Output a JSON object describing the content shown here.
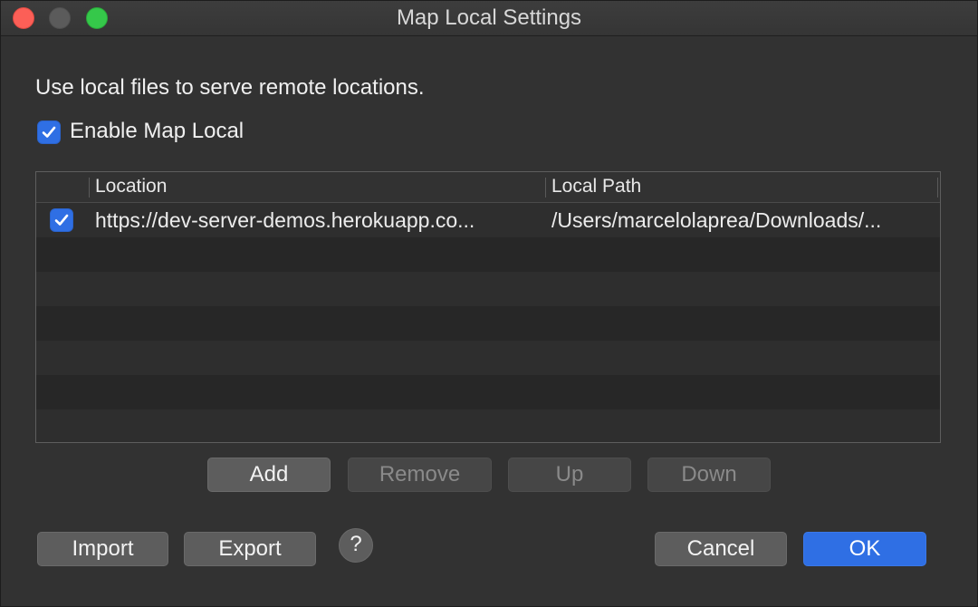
{
  "window": {
    "title": "Map Local Settings"
  },
  "description": "Use local files to serve remote locations.",
  "enable": {
    "label": "Enable Map Local",
    "checked": true
  },
  "table": {
    "columns": [
      "Location",
      "Local Path"
    ],
    "rows": [
      {
        "checked": true,
        "location": "https://dev-server-demos.herokuapp.co...",
        "local_path": "/Users/marcelolaprea/Downloads/..."
      }
    ]
  },
  "list_buttons": {
    "add": "Add",
    "remove": "Remove",
    "up": "Up",
    "down": "Down"
  },
  "footer": {
    "import": "Import",
    "export": "Export",
    "help": "?",
    "cancel": "Cancel",
    "ok": "OK"
  },
  "colors": {
    "accent": "#2f6fe4",
    "close": "#fc5f57",
    "maximize": "#35c84a"
  }
}
